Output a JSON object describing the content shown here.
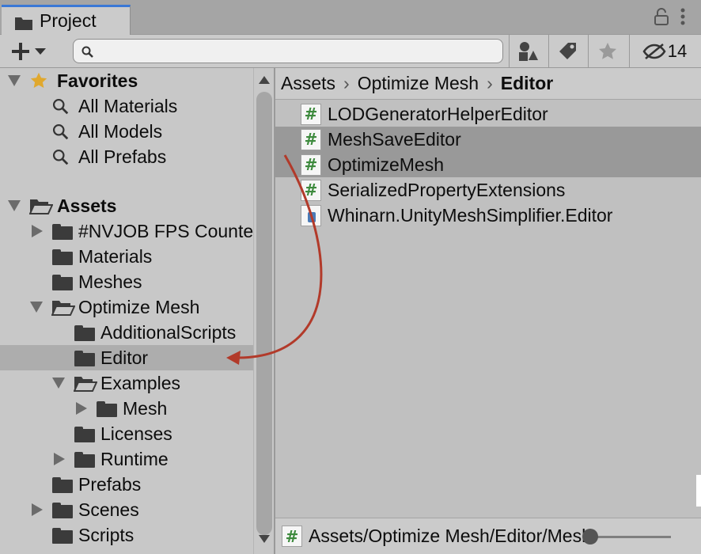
{
  "tab": {
    "title": "Project"
  },
  "toolbar": {
    "hidden_count": "14"
  },
  "favorites": {
    "label": "Favorites",
    "items": [
      "All Materials",
      "All Models",
      "All Prefabs"
    ]
  },
  "assets": {
    "label": "Assets",
    "items": [
      "#NVJOB FPS Counter",
      "Materials",
      "Meshes",
      "Optimize Mesh",
      "AdditionalScripts",
      "Editor",
      "Examples",
      "Mesh",
      "Licenses",
      "Runtime",
      "Prefabs",
      "Scenes",
      "Scripts"
    ]
  },
  "breadcrumb": [
    "Assets",
    "Optimize Mesh",
    "Editor"
  ],
  "files": [
    "LODGeneratorHelperEditor",
    "MeshSaveEditor",
    "OptimizeMesh",
    "SerializedPropertyExtensions",
    "Whinarn.UnityMeshSimplifier.Editor"
  ],
  "status": {
    "path": "Assets/Optimize Mesh/Editor/MeshSaveEditor.cs"
  },
  "colors": {
    "tab_accent": "#3a78d6",
    "annotation_arrow": "#b23a2a",
    "script_icon": "#3d8a3d"
  }
}
